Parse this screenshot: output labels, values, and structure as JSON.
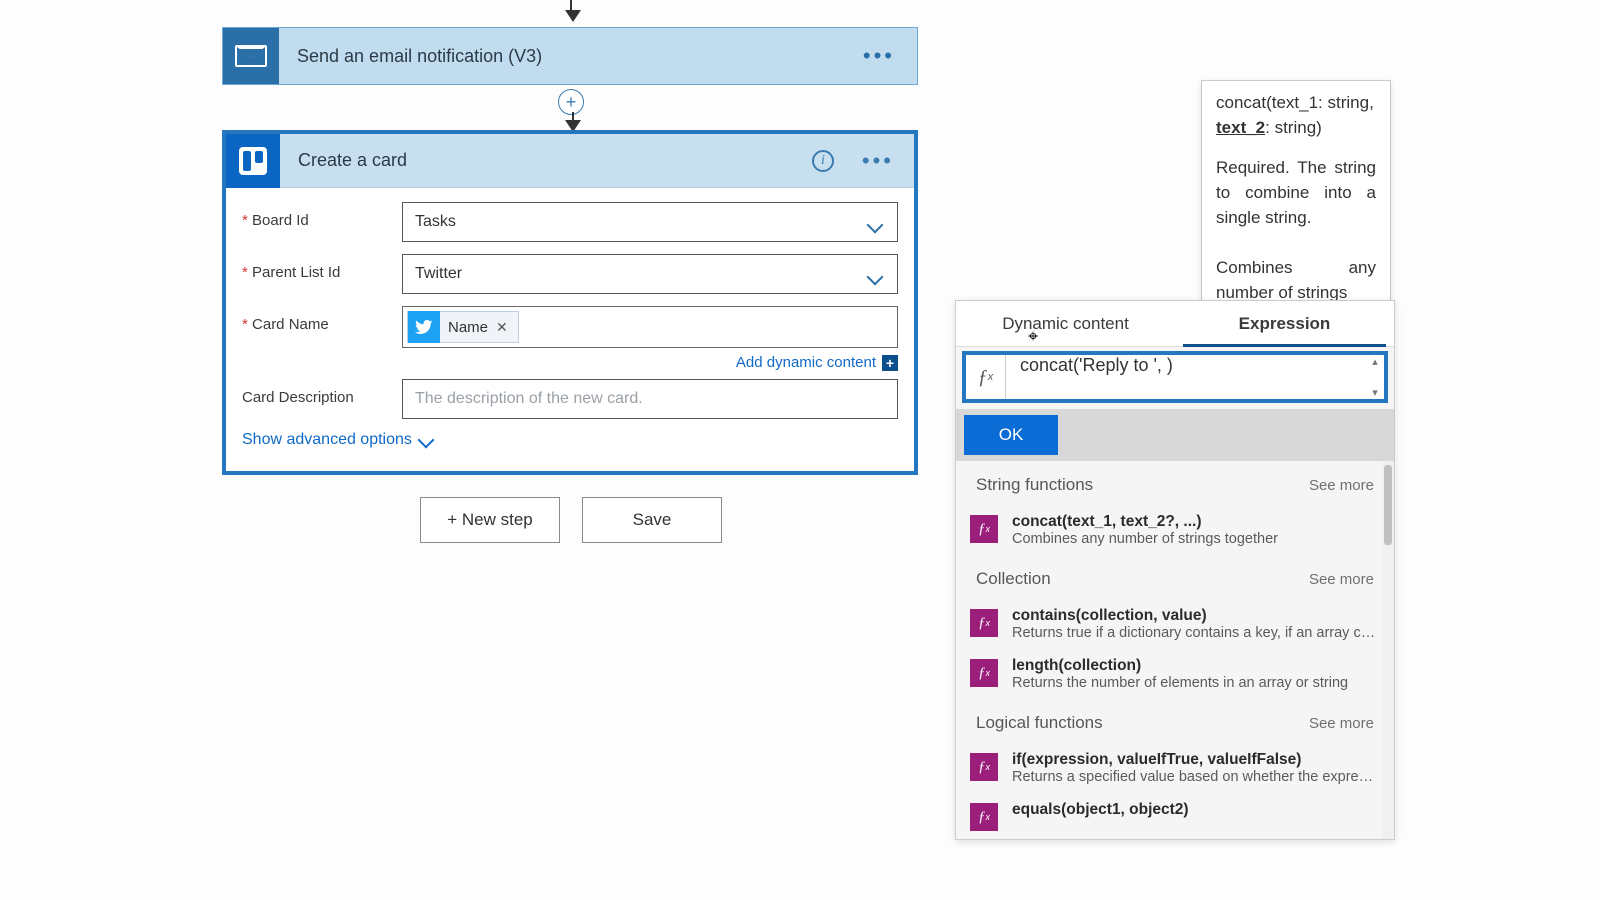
{
  "emailStep": {
    "title": "Send an email notification (V3)"
  },
  "createCard": {
    "title": "Create a card",
    "fields": {
      "boardId": {
        "label": "Board Id",
        "value": "Tasks"
      },
      "parentListId": {
        "label": "Parent List Id",
        "value": "Twitter"
      },
      "cardName": {
        "label": "Card Name",
        "token": "Name"
      },
      "cardDesc": {
        "label": "Card Description",
        "placeholder": "The description of the new card."
      }
    },
    "addDynamic": "Add dynamic content",
    "advanced": "Show advanced options"
  },
  "buttons": {
    "newStep": "+ New step",
    "save": "Save"
  },
  "tooltip": {
    "sigPrefix": "concat(text_1: string, ",
    "sigCurrent": "text_2",
    "sigSuffix": ": string)",
    "req": "Required. The string to combine into a single string.",
    "combine": "Combines any number of strings"
  },
  "exprPanel": {
    "tabs": {
      "dynamic": "Dynamic content",
      "expression": "Expression"
    },
    "formula": "concat('Reply to ', )",
    "ok": "OK",
    "seeMore": "See more",
    "categories": {
      "string": "String functions",
      "collection": "Collection",
      "logical": "Logical functions"
    },
    "fns": {
      "concat": {
        "sig": "concat(text_1, text_2?, ...)",
        "desc": "Combines any number of strings together"
      },
      "contains": {
        "sig": "contains(collection, value)",
        "desc": "Returns true if a dictionary contains a key, if an array cont..."
      },
      "length": {
        "sig": "length(collection)",
        "desc": "Returns the number of elements in an array or string"
      },
      "if": {
        "sig": "if(expression, valueIfTrue, valueIfFalse)",
        "desc": "Returns a specified value based on whether the expressio..."
      },
      "equals": {
        "sig": "equals(object1, object2)",
        "desc": ""
      }
    }
  }
}
